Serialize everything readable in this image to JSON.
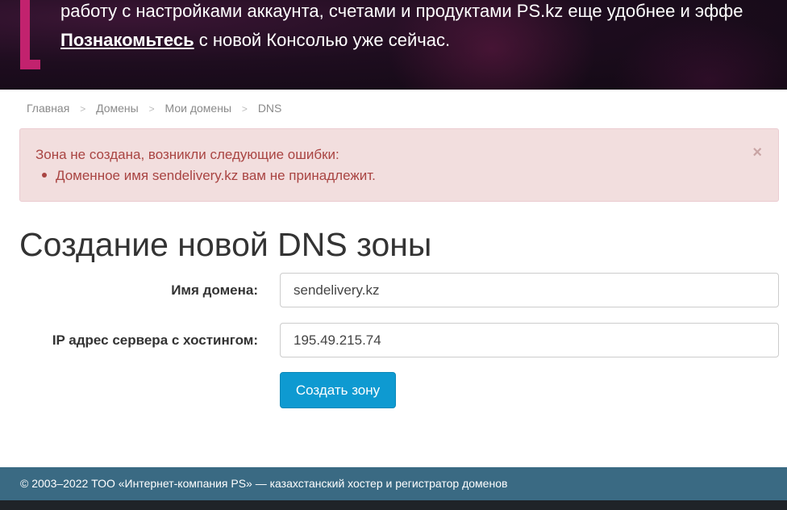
{
  "banner": {
    "line1": "работу с настройками аккаунта, счетами и продуктами PS.kz еще удобнее и эффе",
    "link_text": "Познакомьтесь",
    "line2_rest": " с новой Консолью уже сейчас."
  },
  "breadcrumb": {
    "items": [
      "Главная",
      "Домены",
      "Мои домены",
      "DNS"
    ],
    "separator": ">"
  },
  "alert": {
    "title": "Зона не создана, возникли следующие ошибки:",
    "errors": [
      "Доменное имя sendelivery.kz вам не принадлежит."
    ],
    "close": "×"
  },
  "page": {
    "title": "Создание новой DNS зоны"
  },
  "form": {
    "domain_label": "Имя домена:",
    "domain_value": "sendelivery.kz",
    "ip_label": "IP адрес сервера с хостингом:",
    "ip_value": "195.49.215.74",
    "submit_label": "Создать зону"
  },
  "footer": {
    "text": "© 2003–2022 ТОО «Интернет-компания PS» — казахстанский хостер и регистратор доменов"
  },
  "colors": {
    "accent": "#c2226e",
    "button": "#0e9ad1",
    "alert_text": "#a94442",
    "footer_bg": "#3a6a83"
  }
}
